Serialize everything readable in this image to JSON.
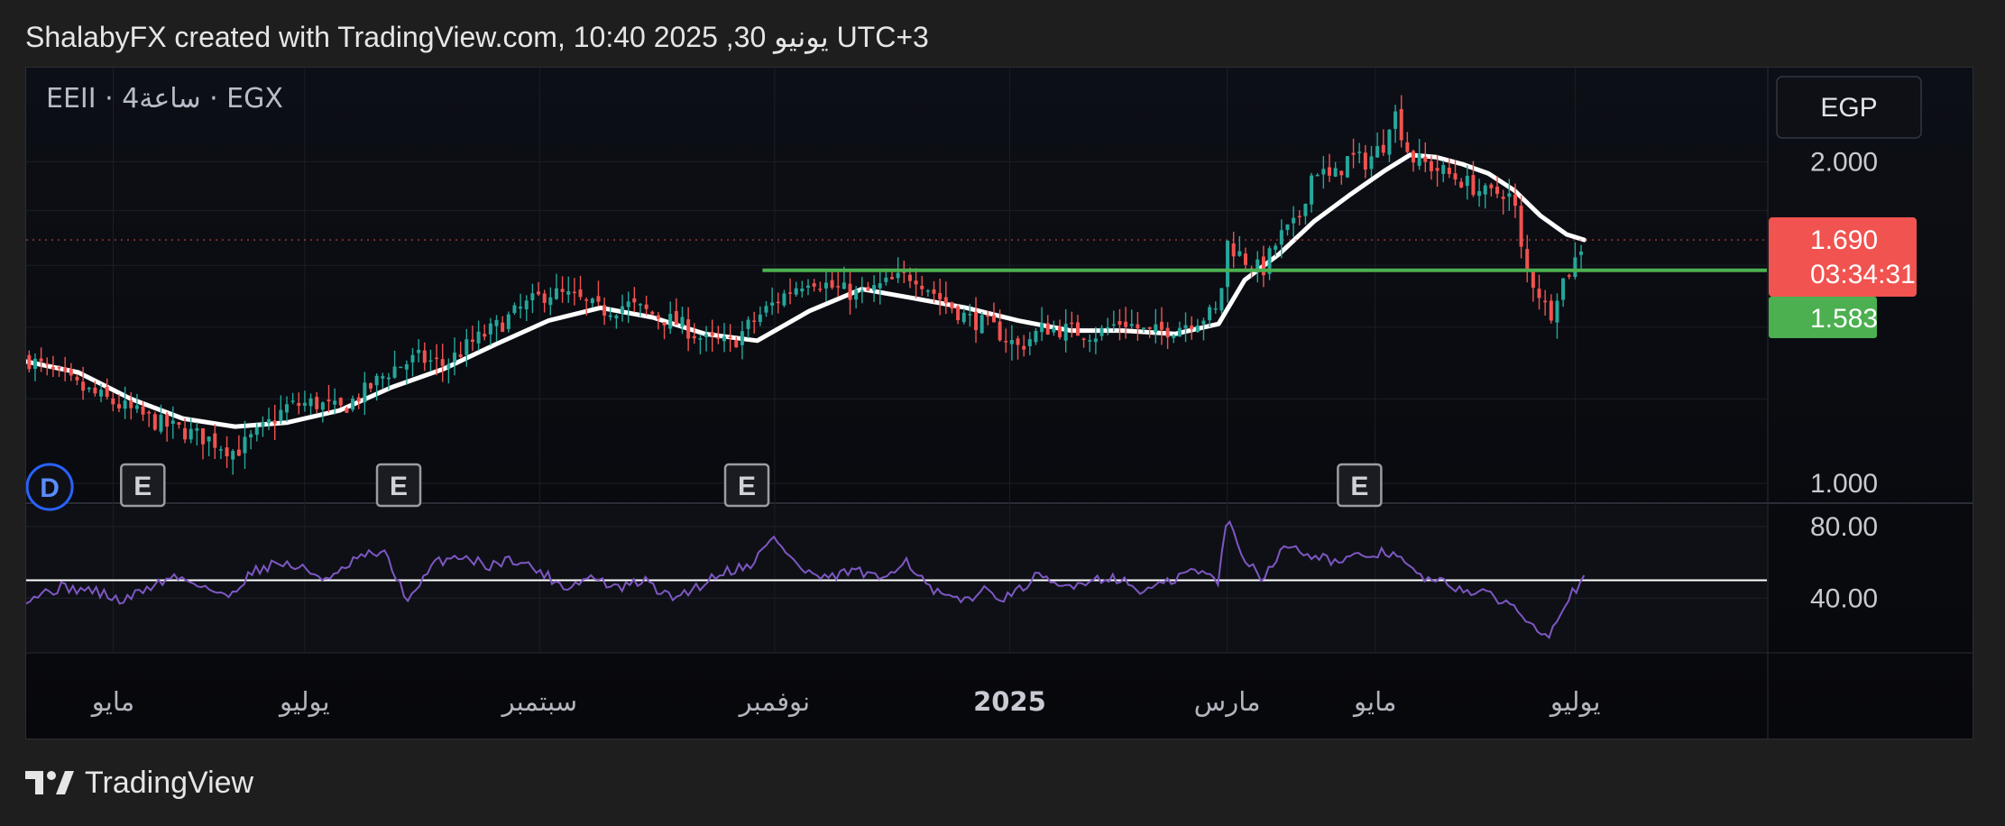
{
  "header": {
    "attribution": "ShalabyFX created with TradingView.com, 10:40 2025 ,30 يونيو UTC+3"
  },
  "footer": {
    "brand": "TradingView",
    "logo_icon": "tradingview-logo-icon"
  },
  "colors": {
    "up": "#26a69a",
    "down": "#ef5350",
    "ma_line": "#ffffff",
    "support_line": "#4caf50",
    "rsi_line": "#7e57c2",
    "last_price_badge": "#f05350",
    "support_badge": "#4caf50"
  },
  "chart_data": [
    {
      "type": "candlestick",
      "symbol_label": "EEII · 4ساعة · EGX",
      "currency_button": "EGP",
      "y_scale": "log",
      "ylim": [
        0.96,
        2.45
      ],
      "y_ticks": [
        {
          "value": 2.0,
          "label": "2.000"
        },
        {
          "value": 1.0,
          "label": "1.000"
        }
      ],
      "x_ticks": [
        {
          "t": 0.05,
          "label": "مايو",
          "bold": false
        },
        {
          "t": 0.16,
          "label": "يوليو",
          "bold": false
        },
        {
          "t": 0.295,
          "label": "سبتمبر",
          "bold": false
        },
        {
          "t": 0.43,
          "label": "نوفمبر",
          "bold": false
        },
        {
          "t": 0.565,
          "label": "2025",
          "bold": true
        },
        {
          "t": 0.69,
          "label": "مارس",
          "bold": false
        },
        {
          "t": 0.775,
          "label": "مايو",
          "bold": false
        },
        {
          "t": 0.89,
          "label": "يوليو",
          "bold": false
        }
      ],
      "close_path": [
        [
          0.0,
          1.31
        ],
        [
          0.015,
          1.27
        ],
        [
          0.03,
          1.23
        ],
        [
          0.045,
          1.2
        ],
        [
          0.06,
          1.17
        ],
        [
          0.075,
          1.14
        ],
        [
          0.09,
          1.12
        ],
        [
          0.105,
          1.1
        ],
        [
          0.12,
          1.07
        ],
        [
          0.135,
          1.12
        ],
        [
          0.15,
          1.18
        ],
        [
          0.165,
          1.19
        ],
        [
          0.18,
          1.17
        ],
        [
          0.195,
          1.22
        ],
        [
          0.21,
          1.28
        ],
        [
          0.225,
          1.31
        ],
        [
          0.24,
          1.29
        ],
        [
          0.255,
          1.35
        ],
        [
          0.27,
          1.4
        ],
        [
          0.285,
          1.46
        ],
        [
          0.3,
          1.51
        ],
        [
          0.315,
          1.49
        ],
        [
          0.33,
          1.45
        ],
        [
          0.345,
          1.47
        ],
        [
          0.36,
          1.44
        ],
        [
          0.375,
          1.41
        ],
        [
          0.39,
          1.36
        ],
        [
          0.405,
          1.35
        ],
        [
          0.42,
          1.43
        ],
        [
          0.435,
          1.5
        ],
        [
          0.45,
          1.56
        ],
        [
          0.465,
          1.52
        ],
        [
          0.48,
          1.5
        ],
        [
          0.495,
          1.54
        ],
        [
          0.51,
          1.57
        ],
        [
          0.525,
          1.49
        ],
        [
          0.54,
          1.43
        ],
        [
          0.555,
          1.4
        ],
        [
          0.57,
          1.34
        ],
        [
          0.585,
          1.4
        ],
        [
          0.6,
          1.39
        ],
        [
          0.615,
          1.38
        ],
        [
          0.63,
          1.42
        ],
        [
          0.645,
          1.38
        ],
        [
          0.66,
          1.4
        ],
        [
          0.675,
          1.43
        ],
        [
          0.685,
          1.45
        ],
        [
          0.69,
          1.68
        ],
        [
          0.7,
          1.62
        ],
        [
          0.71,
          1.58
        ],
        [
          0.72,
          1.7
        ],
        [
          0.73,
          1.75
        ],
        [
          0.74,
          1.98
        ],
        [
          0.75,
          1.92
        ],
        [
          0.76,
          2.02
        ],
        [
          0.77,
          2.0
        ],
        [
          0.78,
          2.08
        ],
        [
          0.785,
          2.25
        ],
        [
          0.795,
          2.02
        ],
        [
          0.81,
          1.97
        ],
        [
          0.825,
          1.92
        ],
        [
          0.84,
          1.86
        ],
        [
          0.85,
          1.88
        ],
        [
          0.855,
          1.82
        ],
        [
          0.86,
          1.6
        ],
        [
          0.87,
          1.5
        ],
        [
          0.875,
          1.43
        ],
        [
          0.88,
          1.52
        ],
        [
          0.89,
          1.62
        ],
        [
          0.895,
          1.69
        ]
      ],
      "moving_average": [
        [
          0.0,
          1.3
        ],
        [
          0.03,
          1.27
        ],
        [
          0.06,
          1.2
        ],
        [
          0.09,
          1.15
        ],
        [
          0.12,
          1.13
        ],
        [
          0.15,
          1.14
        ],
        [
          0.18,
          1.17
        ],
        [
          0.21,
          1.23
        ],
        [
          0.24,
          1.28
        ],
        [
          0.27,
          1.35
        ],
        [
          0.3,
          1.42
        ],
        [
          0.33,
          1.46
        ],
        [
          0.36,
          1.43
        ],
        [
          0.39,
          1.38
        ],
        [
          0.42,
          1.36
        ],
        [
          0.45,
          1.45
        ],
        [
          0.48,
          1.52
        ],
        [
          0.51,
          1.49
        ],
        [
          0.54,
          1.46
        ],
        [
          0.57,
          1.42
        ],
        [
          0.6,
          1.39
        ],
        [
          0.63,
          1.39
        ],
        [
          0.66,
          1.38
        ],
        [
          0.685,
          1.41
        ],
        [
          0.7,
          1.55
        ],
        [
          0.72,
          1.64
        ],
        [
          0.74,
          1.76
        ],
        [
          0.76,
          1.86
        ],
        [
          0.78,
          1.96
        ],
        [
          0.795,
          2.03
        ],
        [
          0.81,
          2.02
        ],
        [
          0.825,
          1.99
        ],
        [
          0.84,
          1.95
        ],
        [
          0.855,
          1.88
        ],
        [
          0.87,
          1.78
        ],
        [
          0.885,
          1.71
        ],
        [
          0.895,
          1.69
        ]
      ],
      "candle_count": 260,
      "support_level": {
        "value": 1.583,
        "label": "1.583",
        "from_t": 0.423
      },
      "last_price": {
        "value": 1.69,
        "label": "1.690",
        "countdown": "03:34:31"
      },
      "earnings_markers": [
        {
          "t": 0.067,
          "label": "E"
        },
        {
          "t": 0.214,
          "label": "E"
        },
        {
          "t": 0.414,
          "label": "E"
        },
        {
          "t": 0.766,
          "label": "E"
        }
      ],
      "dividend_marker": {
        "t": 0.013,
        "label": "D"
      }
    },
    {
      "type": "line",
      "indicator": "RSI",
      "ylim": [
        10,
        92
      ],
      "y_ticks": [
        {
          "value": 80,
          "label": "80.00"
        },
        {
          "value": 40,
          "label": "40.00"
        }
      ],
      "midline": 50,
      "series": [
        [
          0.0,
          40
        ],
        [
          0.02,
          46
        ],
        [
          0.04,
          44
        ],
        [
          0.055,
          38
        ],
        [
          0.07,
          46
        ],
        [
          0.085,
          52
        ],
        [
          0.1,
          48
        ],
        [
          0.115,
          40
        ],
        [
          0.13,
          55
        ],
        [
          0.145,
          60
        ],
        [
          0.16,
          56
        ],
        [
          0.175,
          50
        ],
        [
          0.19,
          62
        ],
        [
          0.205,
          66
        ],
        [
          0.22,
          38
        ],
        [
          0.235,
          60
        ],
        [
          0.25,
          64
        ],
        [
          0.265,
          58
        ],
        [
          0.28,
          62
        ],
        [
          0.295,
          55
        ],
        [
          0.31,
          46
        ],
        [
          0.325,
          52
        ],
        [
          0.34,
          45
        ],
        [
          0.355,
          50
        ],
        [
          0.37,
          40
        ],
        [
          0.385,
          46
        ],
        [
          0.4,
          55
        ],
        [
          0.415,
          58
        ],
        [
          0.43,
          74
        ],
        [
          0.445,
          56
        ],
        [
          0.46,
          50
        ],
        [
          0.475,
          56
        ],
        [
          0.49,
          50
        ],
        [
          0.505,
          62
        ],
        [
          0.52,
          44
        ],
        [
          0.535,
          38
        ],
        [
          0.55,
          44
        ],
        [
          0.565,
          40
        ],
        [
          0.58,
          52
        ],
        [
          0.595,
          46
        ],
        [
          0.61,
          50
        ],
        [
          0.625,
          52
        ],
        [
          0.64,
          44
        ],
        [
          0.655,
          48
        ],
        [
          0.67,
          56
        ],
        [
          0.685,
          50
        ],
        [
          0.69,
          85
        ],
        [
          0.7,
          62
        ],
        [
          0.71,
          52
        ],
        [
          0.725,
          70
        ],
        [
          0.74,
          64
        ],
        [
          0.755,
          60
        ],
        [
          0.77,
          64
        ],
        [
          0.785,
          66
        ],
        [
          0.8,
          52
        ],
        [
          0.815,
          48
        ],
        [
          0.83,
          44
        ],
        [
          0.845,
          40
        ],
        [
          0.855,
          35
        ],
        [
          0.865,
          26
        ],
        [
          0.875,
          20
        ],
        [
          0.885,
          40
        ],
        [
          0.895,
          50
        ]
      ]
    }
  ]
}
